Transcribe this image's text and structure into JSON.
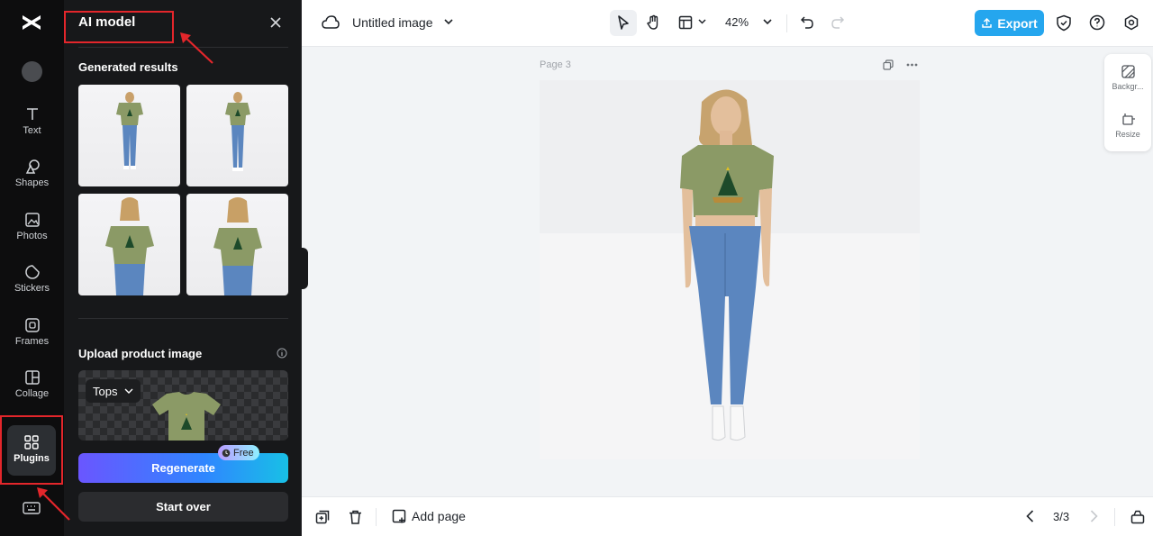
{
  "rail": {
    "items": [
      {
        "label": "Text",
        "icon": "text-icon"
      },
      {
        "label": "Shapes",
        "icon": "shapes-icon"
      },
      {
        "label": "Photos",
        "icon": "photos-icon"
      },
      {
        "label": "Stickers",
        "icon": "stickers-icon"
      },
      {
        "label": "Frames",
        "icon": "frames-icon"
      },
      {
        "label": "Collage",
        "icon": "collage-icon"
      },
      {
        "label": "Plugins",
        "icon": "plugins-icon",
        "active": true
      }
    ]
  },
  "panel": {
    "title": "AI model",
    "generated_title": "Generated results",
    "upload_title": "Upload product image",
    "category": "Tops",
    "regenerate_label": "Regenerate",
    "free_badge": "Free",
    "start_over_label": "Start over"
  },
  "topbar": {
    "doc_title": "Untitled image",
    "zoom": "42%",
    "export_label": "Export"
  },
  "canvas": {
    "page_label": "Page 3"
  },
  "dock": {
    "background_label": "Backgr...",
    "resize_label": "Resize"
  },
  "bottombar": {
    "add_page_label": "Add page",
    "page_count": "3/3"
  },
  "colors": {
    "accent": "#25a6ee",
    "shirt": "#8b9a66",
    "jeans": "#5b86bf",
    "annotation": "#e3262b"
  }
}
